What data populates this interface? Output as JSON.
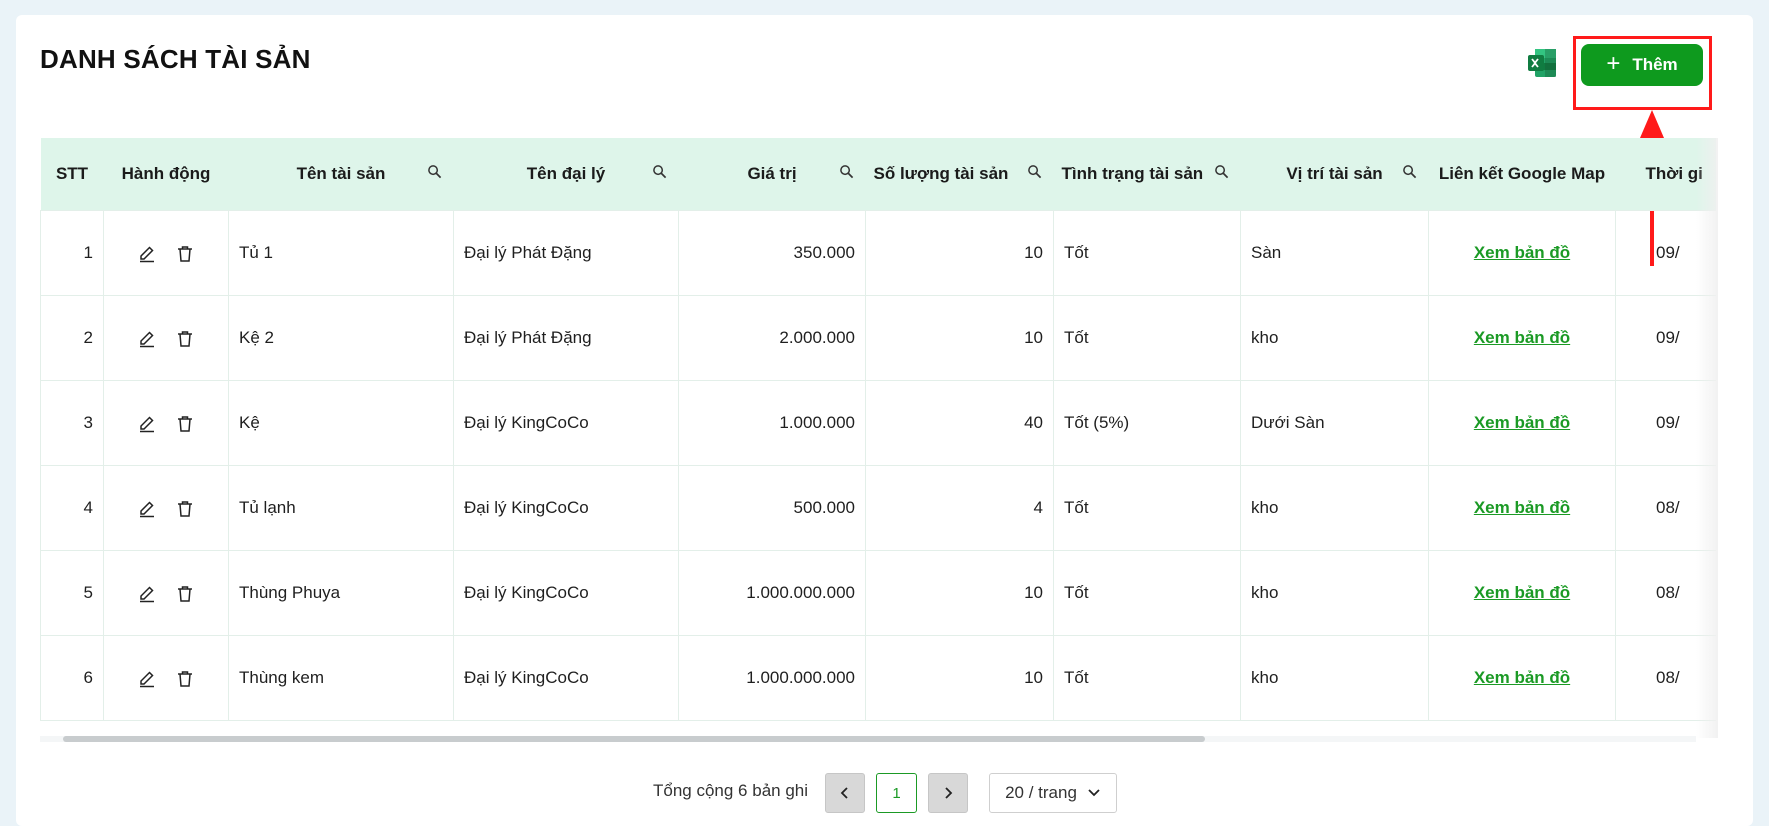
{
  "page": {
    "title": "DANH SÁCH TÀI SẢN"
  },
  "toolbar": {
    "add_label": "Thêm",
    "add_icon": "plus-icon",
    "export_icon": "excel-icon"
  },
  "colors": {
    "accent": "#0e9a1e",
    "header_bg": "#def5ea",
    "link": "#1b9a25",
    "highlight": "#ff1a1a"
  },
  "table": {
    "headers": {
      "stt": "STT",
      "action": "Hành động",
      "name": "Tên tài sản",
      "agency": "Tên đại lý",
      "value": "Giá trị",
      "quantity": "Số lượng tài sản",
      "status": "Tình trạng tài sản",
      "location": "Vị trí tài sản",
      "map": "Liên kết Google Map",
      "time": "Thời gi"
    },
    "rows": [
      {
        "stt": "1",
        "name": "Tủ 1",
        "agency": "Đại lý Phát Đặng",
        "value": "350.000",
        "quantity": "10",
        "status": "Tốt",
        "location": "Sàn",
        "map": "Xem bản đồ",
        "time": "09/"
      },
      {
        "stt": "2",
        "name": "Kệ 2",
        "agency": "Đại lý Phát Đặng",
        "value": "2.000.000",
        "quantity": "10",
        "status": "Tốt",
        "location": "kho",
        "map": "Xem bản đồ",
        "time": "09/"
      },
      {
        "stt": "3",
        "name": "Kệ",
        "agency": "Đại lý KingCoCo",
        "value": "1.000.000",
        "quantity": "40",
        "status": "Tốt (5%)",
        "location": "Dưới Sàn",
        "map": "Xem bản đồ",
        "time": "09/"
      },
      {
        "stt": "4",
        "name": "Tủ lạnh",
        "agency": "Đại lý KingCoCo",
        "value": "500.000",
        "quantity": "4",
        "status": "Tốt",
        "location": "kho",
        "map": "Xem bản đồ",
        "time": "08/"
      },
      {
        "stt": "5",
        "name": "Thùng Phuya",
        "agency": "Đại lý KingCoCo",
        "value": "1.000.000.000",
        "quantity": "10",
        "status": "Tốt",
        "location": "kho",
        "map": "Xem bản đồ",
        "time": "08/"
      },
      {
        "stt": "6",
        "name": "Thùng kem",
        "agency": "Đại lý KingCoCo",
        "value": "1.000.000.000",
        "quantity": "10",
        "status": "Tốt",
        "location": "kho",
        "map": "Xem bản đồ",
        "time": "08/"
      }
    ]
  },
  "pagination": {
    "total_text": "Tổng cộng 6 bản ghi",
    "current_page": "1",
    "page_size": "20 / trang"
  }
}
